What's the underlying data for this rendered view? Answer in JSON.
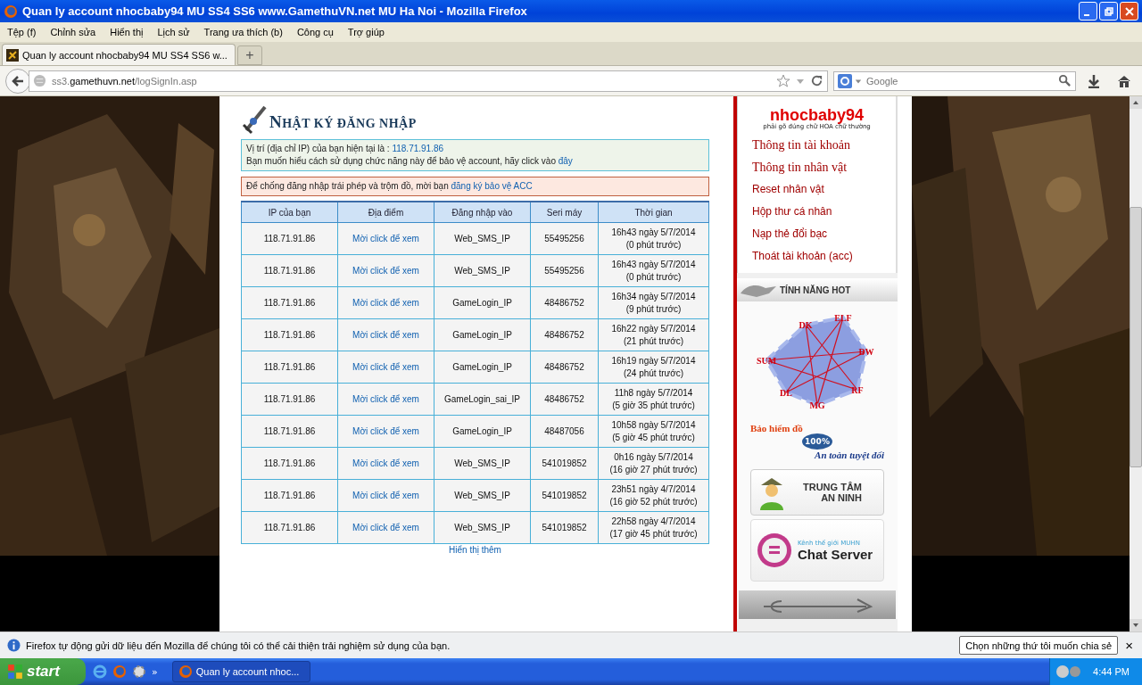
{
  "window": {
    "title": "Quan ly account nhocbaby94 MU SS4 SS6 www.GamethuVN.net MU Ha Noi - Mozilla Firefox"
  },
  "menu": [
    {
      "label": "Tệp (f)"
    },
    {
      "label": "Chỉnh sửa"
    },
    {
      "label": "Hiển thị"
    },
    {
      "label": "Lịch sử"
    },
    {
      "label": "Trang ưa thích (b)"
    },
    {
      "label": "Công cụ"
    },
    {
      "label": "Trợ giúp"
    }
  ],
  "tabs": [
    {
      "label": "Quan ly account nhocbaby94 MU SS4 SS6 w...",
      "selected": true
    }
  ],
  "new_tab": "+",
  "address_bar": {
    "prefix": "ss3.",
    "domain": "gamethuvn.net",
    "path": "/logSignIn.asp"
  },
  "search": {
    "placeholder": "Google"
  },
  "page": {
    "heading": "NHẬT KÝ ĐĂNG NHẬP",
    "info": [
      {
        "text": "Vị trí (địa chỉ IP) của bạn hiện tại là : ",
        "link": "118.71.91.86"
      },
      {
        "text": "Bạn muốn hiểu cách sử dụng chức năng này để bảo vệ account, hãy click vào ",
        "link": "đây"
      }
    ],
    "warning": {
      "text": "Để chống đăng nhập trái phép và trộm đồ, mời bạn ",
      "link": "đăng ký bảo vệ ACC"
    },
    "table": {
      "columns": [
        "IP của bạn",
        "Địa điểm",
        "Đăng nhập vào",
        "Seri máy",
        "Thời gian"
      ],
      "rows": [
        {
          "ip": "118.71.91.86",
          "location": "Mời click để xem",
          "login": "Web_SMS_IP",
          "serial": "55495256",
          "time": "16h43 ngày 5/7/2014",
          "ago": "(0 phút trước)"
        },
        {
          "ip": "118.71.91.86",
          "location": "Mời click để xem",
          "login": "Web_SMS_IP",
          "serial": "55495256",
          "time": "16h43 ngày 5/7/2014",
          "ago": "(0 phút trước)"
        },
        {
          "ip": "118.71.91.86",
          "location": "Mời click để xem",
          "login": "GameLogin_IP",
          "serial": "48486752",
          "time": "16h34 ngày 5/7/2014",
          "ago": "(9 phút trước)"
        },
        {
          "ip": "118.71.91.86",
          "location": "Mời click để xem",
          "login": "GameLogin_IP",
          "serial": "48486752",
          "time": "16h22 ngày 5/7/2014",
          "ago": "(21 phút trước)"
        },
        {
          "ip": "118.71.91.86",
          "location": "Mời click để xem",
          "login": "GameLogin_IP",
          "serial": "48486752",
          "time": "16h19 ngày 5/7/2014",
          "ago": "(24 phút trước)"
        },
        {
          "ip": "118.71.91.86",
          "location": "Mời click để xem",
          "login": "GameLogin_sai_IP",
          "serial": "48486752",
          "time": "11h8 ngày 5/7/2014",
          "ago": "(5 giờ 35 phút trước)"
        },
        {
          "ip": "118.71.91.86",
          "location": "Mời click để xem",
          "login": "GameLogin_IP",
          "serial": "48487056",
          "time": "10h58 ngày 5/7/2014",
          "ago": "(5 giờ 45 phút trước)"
        },
        {
          "ip": "118.71.91.86",
          "location": "Mời click để xem",
          "login": "Web_SMS_IP",
          "serial": "541019852",
          "time": "0h16 ngày 5/7/2014",
          "ago": "(16 giờ 27 phút trước)"
        },
        {
          "ip": "118.71.91.86",
          "location": "Mời click để xem",
          "login": "Web_SMS_IP",
          "serial": "541019852",
          "time": "23h51 ngày 4/7/2014",
          "ago": "(16 giờ 52 phút trước)"
        },
        {
          "ip": "118.71.91.86",
          "location": "Mời click để xem",
          "login": "Web_SMS_IP",
          "serial": "541019852",
          "time": "22h58 ngày 4/7/2014",
          "ago": "(17 giờ 45 phút trước)"
        }
      ]
    },
    "more_link": "Hiển thị thêm"
  },
  "sidebar": {
    "username": "nhocbaby94",
    "note": "phải gõ đúng chữ HOA chữ thường",
    "items": [
      {
        "label": "Thông tin tài khoản"
      },
      {
        "label": "Thông tin nhân vật"
      },
      {
        "label": "Reset nhân vật"
      },
      {
        "label": "Hộp thư cá nhân"
      },
      {
        "label": "Nạp thẻ đổi bạc"
      },
      {
        "label": "Thoát tài khoản (acc)"
      }
    ],
    "section": "TÍNH NĂNG HOT",
    "classes": [
      "DK",
      "ELF",
      "DW",
      "RF",
      "MG",
      "DL",
      "SUM"
    ],
    "insurance": {
      "title": "Bảo hiểm đồ",
      "seal": "100%",
      "subtitle": "An toàn tuyệt đối"
    },
    "security": [
      "TRUNG TÂM",
      "AN NINH"
    ],
    "chat": {
      "caption": "Kênh thế giới MUHN",
      "title": "Chat Server"
    }
  },
  "notification": {
    "text": "Firefox tự động gửi dữ liệu đến Mozilla để chúng tôi có thể cải thiện trải nghiệm sử dụng của bạn.",
    "button": "Chọn những thứ tôi muốn chia sẻ",
    "close": "×"
  },
  "taskbar": {
    "start": "start",
    "more": "»",
    "task": "Quan ly account nhoc...",
    "clock": "4:44 PM"
  }
}
